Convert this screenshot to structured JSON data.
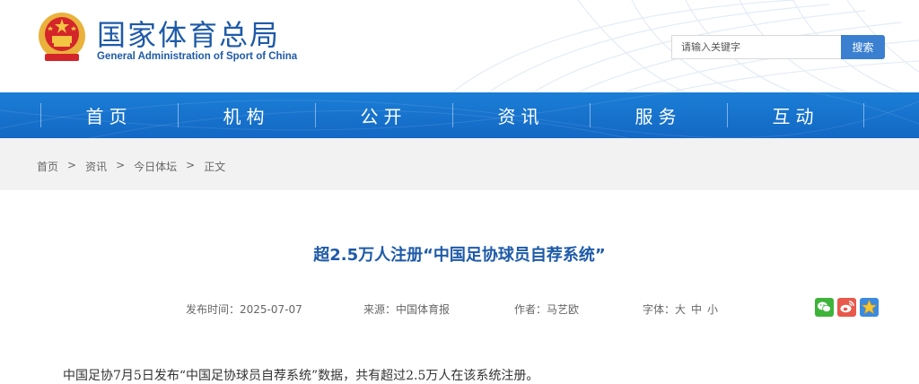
{
  "header": {
    "title_cn": "国家体育总局",
    "title_en": "General Administration of Sport of China",
    "search_placeholder": "请输入关键字",
    "search_button": "搜索",
    "emblem_icon": "national-emblem-icon"
  },
  "nav": {
    "items": [
      {
        "label": "首页"
      },
      {
        "label": "机构"
      },
      {
        "label": "公开"
      },
      {
        "label": "资讯"
      },
      {
        "label": "服务"
      },
      {
        "label": "互动"
      }
    ]
  },
  "breadcrumb": {
    "items": [
      "首页",
      ">",
      "资讯",
      ">",
      "今日体坛",
      ">",
      "正文"
    ]
  },
  "article": {
    "title": "超2.5万人注册“中国足协球员自荐系统”",
    "publish_time": "发布时间：2025-07-07",
    "source": "来源：中国体育报",
    "author": "作者：马艺欧",
    "font_label": "字体：",
    "font_large": "大",
    "font_medium": "中",
    "font_small": "小",
    "body": "中国足协7月5日发布“中国足协球员自荐系统”数据，共有超过2.5万人在该系统注册。"
  },
  "share": {
    "wechat_icon": "wechat-icon",
    "weibo_icon": "weibo-icon",
    "favorite_icon": "star-icon"
  },
  "colors": {
    "brand_blue": "#1e5aa8",
    "nav_blue": "#1670cc",
    "search_button": "#3a7fd0",
    "wechat": "#3eb33a",
    "weibo": "#e8584b",
    "favorite": "#3a8ae0"
  }
}
